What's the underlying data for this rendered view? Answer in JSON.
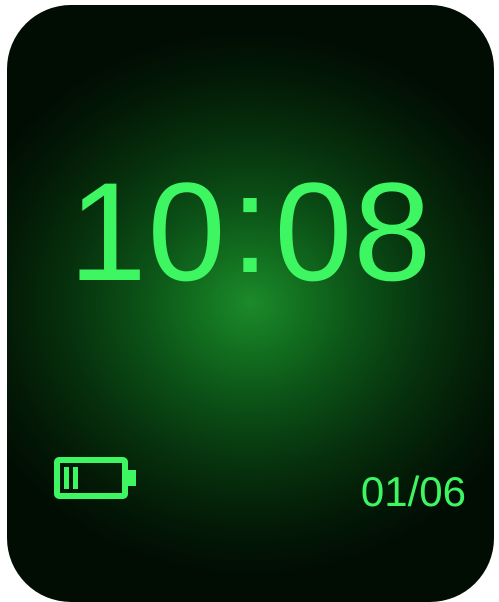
{
  "colors": {
    "accent": "#3ef562",
    "screen_center": "#1c8a2a",
    "screen_edge": "#010c03",
    "frame_background": "#ffffff"
  },
  "watch_face": {
    "time": {
      "hours": "10",
      "separator": ":",
      "minutes": "08"
    },
    "date": "01/06",
    "battery": {
      "icon": "battery-low-icon",
      "level_fraction": 0.3
    }
  }
}
